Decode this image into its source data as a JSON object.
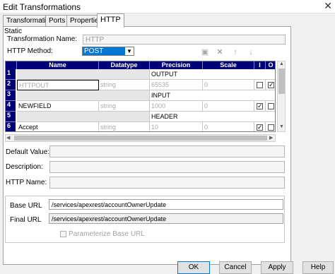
{
  "window": {
    "title": "Edit Transformations",
    "close_glyph": "✕"
  },
  "tabs": [
    "Transformation",
    "Ports",
    "Properties",
    "HTTP"
  ],
  "panel": {
    "static_label": "Static",
    "transformation_name_label": "Transformation Name:",
    "transformation_name_value": "HTTP",
    "http_method_label": "HTTP Method:",
    "http_method_value": "POST"
  },
  "toolbar": {
    "icons": [
      "new-port-icon",
      "delete-icon",
      "move-up-icon",
      "move-down-icon"
    ],
    "glyphs": [
      "▣",
      "✕",
      "↑",
      "↓"
    ]
  },
  "grid": {
    "columns": [
      "Name",
      "Datatype",
      "Precision",
      "Scale",
      "I",
      "O"
    ],
    "rows": [
      {
        "num": "1",
        "section": "OUTPUT"
      },
      {
        "num": "2",
        "name": "HTTPOUT",
        "datatype": "string",
        "precision": "65535",
        "scale": "0",
        "input": false,
        "output": true
      },
      {
        "num": "3",
        "section": "INPUT"
      },
      {
        "num": "4",
        "name": "NEWFIELD",
        "datatype": "string",
        "precision": "1000",
        "scale": "0",
        "input": true,
        "output": false
      },
      {
        "num": "5",
        "section": "HEADER"
      },
      {
        "num": "6",
        "name": "Accept",
        "datatype": "string",
        "precision": "10",
        "scale": "0",
        "input": true,
        "output": false
      }
    ]
  },
  "fields": {
    "default_value_label": "Default Value:",
    "description_label": "Description:",
    "http_name_label": "HTTP Name:"
  },
  "url": {
    "base_url_label": "Base URL",
    "base_url_value": "/services/apexrest/accountOwnerUpdate",
    "final_url_label": "Final URL",
    "final_url_value": "/services/apexrest/accountOwnerUpdate",
    "parameterize_label": "Parameterize Base URL"
  },
  "buttons": {
    "ok": "OK",
    "cancel": "Cancel",
    "apply": "Apply",
    "help": "Help"
  },
  "colors": {
    "grid_header": "#000078",
    "selection": "#0078d7"
  }
}
